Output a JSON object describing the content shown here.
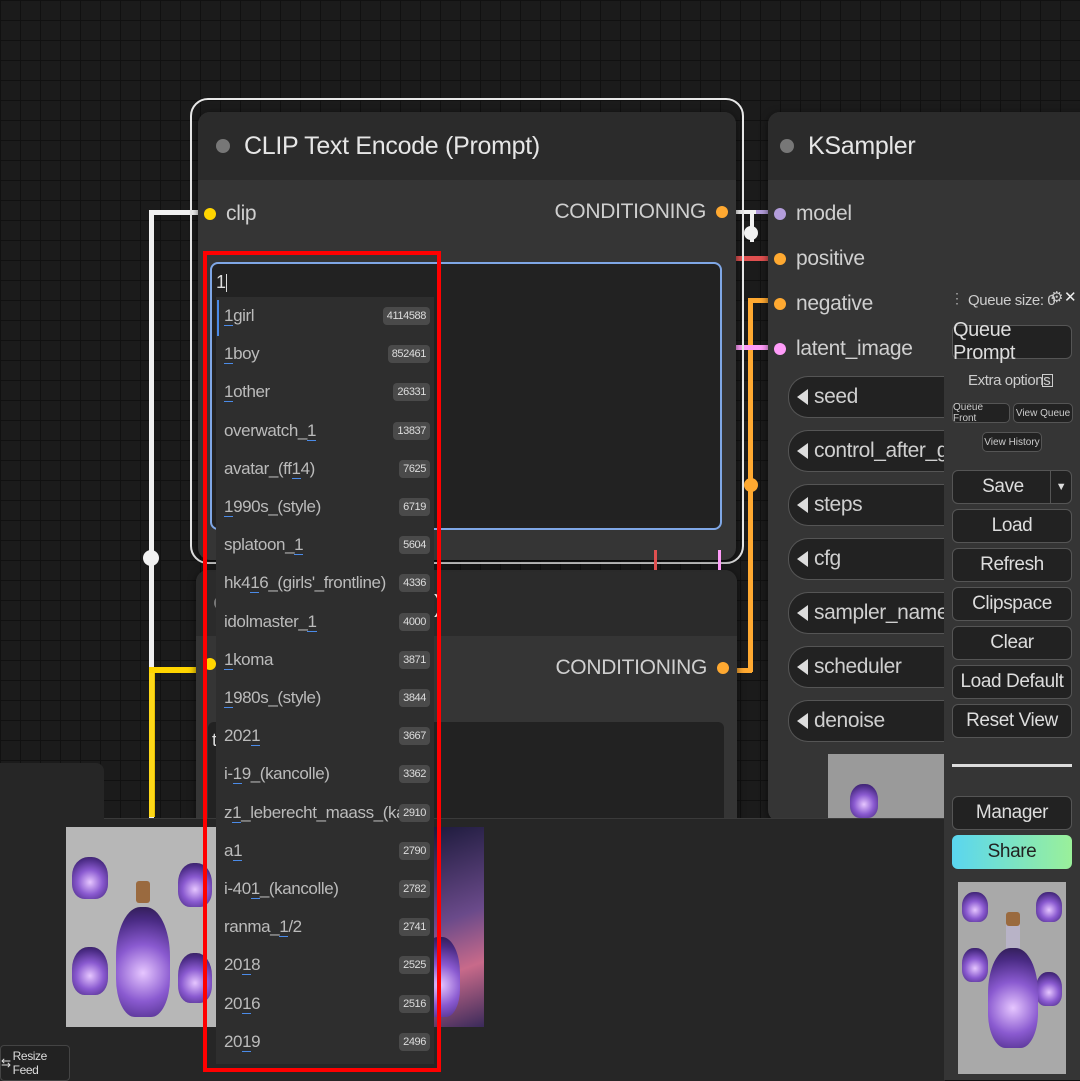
{
  "clip_node": {
    "title": "CLIP Text Encode (Prompt)",
    "input_label": "clip",
    "output_label": "CONDITIONING",
    "prompt_text": "1"
  },
  "clip_node_2": {
    "output_label": "CONDITIONING",
    "title_fragment": ")",
    "text_fragment": "t"
  },
  "ksampler": {
    "title": "KSampler",
    "inputs": [
      "model",
      "positive",
      "negative",
      "latent_image"
    ],
    "widgets": [
      "seed",
      "control_after_gener",
      "steps",
      "cfg",
      "sampler_name",
      "scheduler",
      "denoise"
    ]
  },
  "autocomplete": [
    {
      "pre": "",
      "match": "1",
      "post": "girl",
      "count": "4114588"
    },
    {
      "pre": "",
      "match": "1",
      "post": "boy",
      "count": "852461"
    },
    {
      "pre": "",
      "match": "1",
      "post": "other",
      "count": "26331"
    },
    {
      "pre": "overwatch_",
      "match": "1",
      "post": "",
      "count": "13837"
    },
    {
      "pre": "avatar_(ff",
      "match": "1",
      "post": "4)",
      "count": "7625"
    },
    {
      "pre": "",
      "match": "1",
      "post": "990s_(style)",
      "count": "6719"
    },
    {
      "pre": "splatoon_",
      "match": "1",
      "post": "",
      "count": "5604"
    },
    {
      "pre": "hk4",
      "match": "1",
      "post": "6_(girls'_frontline)",
      "count": "4336"
    },
    {
      "pre": "idolmaster_",
      "match": "1",
      "post": "",
      "count": "4000"
    },
    {
      "pre": "",
      "match": "1",
      "post": "koma",
      "count": "3871"
    },
    {
      "pre": "",
      "match": "1",
      "post": "980s_(style)",
      "count": "3844"
    },
    {
      "pre": "202",
      "match": "1",
      "post": "",
      "count": "3667"
    },
    {
      "pre": "i-",
      "match": "1",
      "post": "9_(kancolle)",
      "count": "3362"
    },
    {
      "pre": "z",
      "match": "1",
      "post": "_leberecht_maass_(kancolle)",
      "count": "2910"
    },
    {
      "pre": "a",
      "match": "1",
      "post": "",
      "count": "2790"
    },
    {
      "pre": "i-40",
      "match": "1",
      "post": "_(kancolle)",
      "count": "2782"
    },
    {
      "pre": "ranma_",
      "match": "1",
      "post": "/2",
      "count": "2741"
    },
    {
      "pre": "20",
      "match": "1",
      "post": "8",
      "count": "2525"
    },
    {
      "pre": "20",
      "match": "1",
      "post": "6",
      "count": "2516"
    },
    {
      "pre": "20",
      "match": "1",
      "post": "9",
      "count": "2496"
    }
  ],
  "menu": {
    "queue_size": "Queue size: 0",
    "queue_prompt": "Queue Prompt",
    "extra_options": "Extra options",
    "queue_front": "Queue Front",
    "view_queue": "View Queue",
    "view_history": "View History",
    "save": "Save",
    "load": "Load",
    "refresh": "Refresh",
    "clipspace": "Clipspace",
    "clear": "Clear",
    "load_default": "Load Default",
    "reset_view": "Reset View",
    "manager": "Manager",
    "share": "Share"
  },
  "feed": {
    "resize_label": "Resize Feed"
  },
  "colors": {
    "clip_wire": "#ffd500",
    "conditioning_wire": "#ffa931",
    "model_wire": "#b39ddb",
    "latent_wire": "#ff9cf9",
    "highlight": "#ff0000",
    "accent_blue": "#7fa7e6"
  }
}
